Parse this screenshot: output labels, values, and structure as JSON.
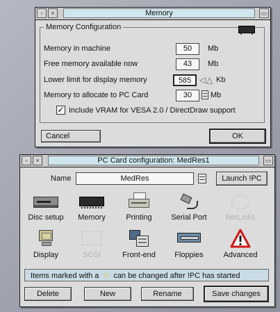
{
  "memory_window": {
    "title": "Memory",
    "group_title": "Memory Configuration",
    "rows": [
      {
        "label": "Memory in machine",
        "value": "50",
        "unit": "Mb"
      },
      {
        "label": "Free memory available now",
        "value": "43",
        "unit": "Mb"
      },
      {
        "label": "Lower limit for display memory",
        "value": "585",
        "unit": "Kb"
      },
      {
        "label": "Memory to allocate to PC Card",
        "value": "30",
        "unit": "Mb"
      }
    ],
    "vram_checkbox_label": "Include VRAM for VESA 2.0 / DirectDraw support",
    "vram_checked": true,
    "cancel_label": "Cancel",
    "ok_label": "OK"
  },
  "pc_card_window": {
    "title": "PC Card configuration: MedRes1",
    "name_label": "Name",
    "name_value": "MedRes",
    "launch_label": "Launch !PC",
    "icons": [
      {
        "label": "Disc setup",
        "icon": "disc-drive-icon",
        "enabled": true
      },
      {
        "label": "Memory",
        "icon": "memory-chip-icon",
        "enabled": true
      },
      {
        "label": "Printing",
        "icon": "printer-icon",
        "enabled": true
      },
      {
        "label": "Serial Port",
        "icon": "serial-cable-icon",
        "enabled": true
      },
      {
        "label": "NetLinks",
        "icon": "network-icon",
        "enabled": false
      },
      {
        "label": "Display",
        "icon": "monitor-icon",
        "enabled": true
      },
      {
        "label": "SCSI",
        "icon": "scsi-icon",
        "enabled": false
      },
      {
        "label": "Front-end",
        "icon": "front-end-icon",
        "enabled": true
      },
      {
        "label": "Floppies",
        "icon": "floppy-drive-icon",
        "enabled": true
      },
      {
        "label": "Advanced",
        "icon": "warning-triangle-icon",
        "enabled": true
      }
    ],
    "info_text_before": "Items marked with a",
    "info_text_after": "can be changed after !PC has started",
    "buttons": {
      "delete": "Delete",
      "new": "New",
      "rename": "Rename",
      "save": "Save changes"
    }
  },
  "colors": {
    "desktop": "#a7aab6",
    "window_bg": "#dcdcdc",
    "title_bg": "#cfe6ee",
    "warning_red": "#d01818",
    "star_yellow": "#e8c020"
  }
}
